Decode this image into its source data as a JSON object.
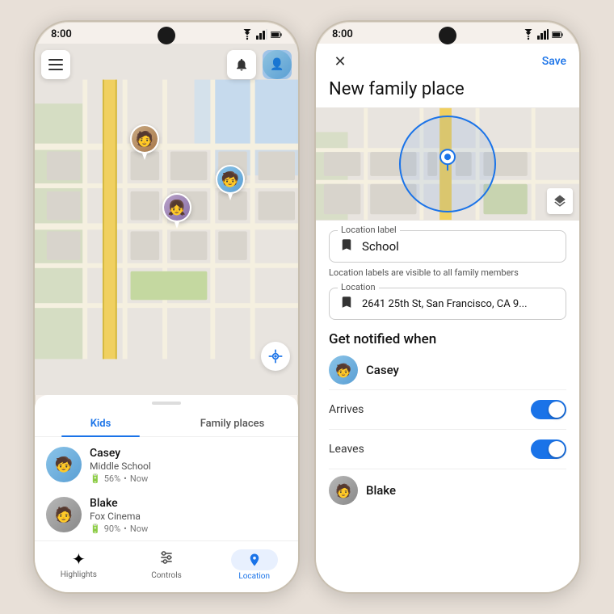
{
  "phone1": {
    "status_time": "8:00",
    "map": {
      "menu_icon": "☰",
      "bell_icon": "🔔",
      "location_icon": "⊙"
    },
    "tabs": [
      {
        "id": "kids",
        "label": "Kids",
        "active": true
      },
      {
        "id": "family_places",
        "label": "Family places",
        "active": false
      }
    ],
    "people": [
      {
        "name": "Casey",
        "place": "Middle School",
        "battery": "56%",
        "status": "Now",
        "avatar_type": "casey"
      },
      {
        "name": "Blake",
        "place": "Fox Cinema",
        "battery": "90%",
        "status": "Now",
        "avatar_type": "blake"
      }
    ],
    "bottom_nav": [
      {
        "id": "highlights",
        "label": "Highlights",
        "icon": "✦",
        "active": false
      },
      {
        "id": "controls",
        "label": "Controls",
        "icon": "⚙",
        "active": false
      },
      {
        "id": "location",
        "label": "Location",
        "icon": "📍",
        "active": true
      }
    ]
  },
  "phone2": {
    "status_time": "8:00",
    "header": {
      "close_label": "✕",
      "save_label": "Save",
      "title": "New family place"
    },
    "location_label": {
      "field_label": "Location label",
      "value": "School",
      "hint": "Location labels are visible to all family members"
    },
    "location_field": {
      "field_label": "Location",
      "value": "2641 25th St, San Francisco, CA 9..."
    },
    "notify_section": {
      "title": "Get notified when",
      "people": [
        {
          "name": "Casey",
          "avatar_type": "casey",
          "toggles": [
            {
              "label": "Arrives",
              "enabled": true
            },
            {
              "label": "Leaves",
              "enabled": true
            }
          ]
        },
        {
          "name": "Blake",
          "avatar_type": "blake",
          "toggles": []
        }
      ]
    }
  }
}
